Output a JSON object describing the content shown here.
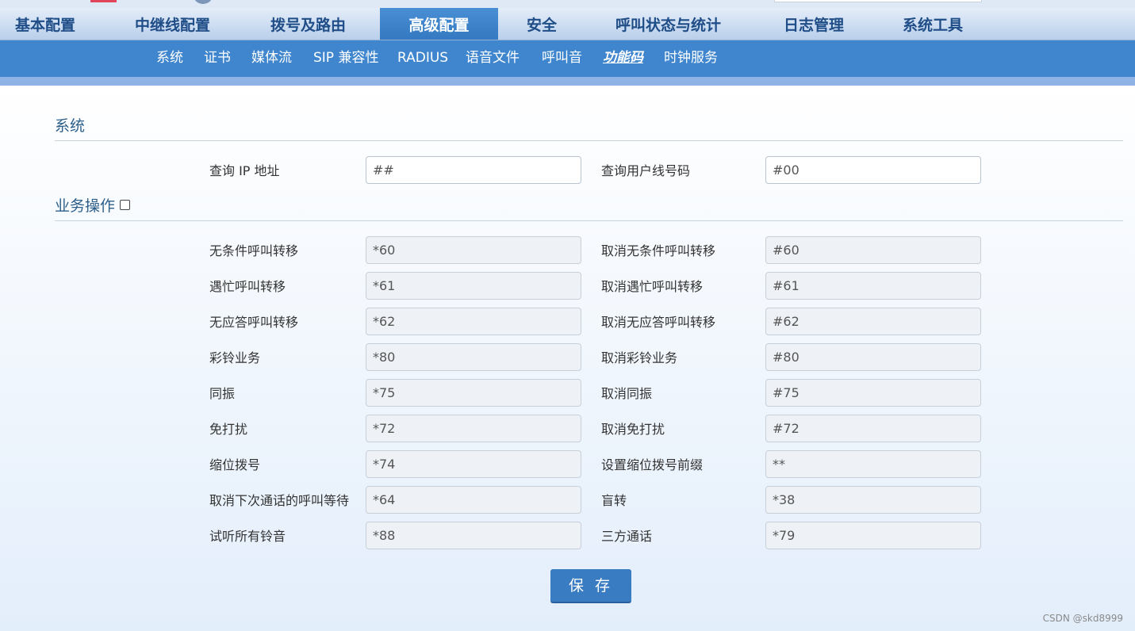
{
  "main_nav": {
    "tabs": [
      {
        "label": "基本配置",
        "active": false
      },
      {
        "label": "中继线配置",
        "active": false
      },
      {
        "label": "拨号及路由",
        "active": false
      },
      {
        "label": "高级配置",
        "active": true
      },
      {
        "label": "安全",
        "active": false
      },
      {
        "label": "呼叫状态与统计",
        "active": false
      },
      {
        "label": "日志管理",
        "active": false
      },
      {
        "label": "系统工具",
        "active": false
      }
    ]
  },
  "sub_nav": {
    "items": [
      {
        "label": "系统",
        "active": false
      },
      {
        "label": "证书",
        "active": false
      },
      {
        "label": "媒体流",
        "active": false
      },
      {
        "label": "SIP 兼容性",
        "active": false
      },
      {
        "label": "RADIUS",
        "active": false
      },
      {
        "label": "语音文件",
        "active": false
      },
      {
        "label": "呼叫音",
        "active": false
      },
      {
        "label": "功能码",
        "active": true
      },
      {
        "label": "时钟服务",
        "active": false
      }
    ]
  },
  "system_section": {
    "title": "系统",
    "fields": [
      {
        "label": "查询 IP 地址",
        "value": "##"
      },
      {
        "label": "查询用户线号码",
        "value": "#00"
      }
    ]
  },
  "service_section": {
    "title": "业务操作",
    "checkbox_checked": false,
    "rows": [
      {
        "left_label": "无条件呼叫转移",
        "left_value": "*60",
        "right_label": "取消无条件呼叫转移",
        "right_value": "#60"
      },
      {
        "left_label": "遇忙呼叫转移",
        "left_value": "*61",
        "right_label": "取消遇忙呼叫转移",
        "right_value": "#61"
      },
      {
        "left_label": "无应答呼叫转移",
        "left_value": "*62",
        "right_label": "取消无应答呼叫转移",
        "right_value": "#62"
      },
      {
        "left_label": "彩铃业务",
        "left_value": "*80",
        "right_label": "取消彩铃业务",
        "right_value": "#80"
      },
      {
        "left_label": "同振",
        "left_value": "*75",
        "right_label": "取消同振",
        "right_value": "#75"
      },
      {
        "left_label": "免打扰",
        "left_value": "*72",
        "right_label": "取消免打扰",
        "right_value": "#72"
      },
      {
        "left_label": "缩位拨号",
        "left_value": "*74",
        "right_label": "设置缩位拨号前缀",
        "right_value": "**"
      },
      {
        "left_label": "取消下次通话的呼叫等待",
        "left_value": "*64",
        "right_label": "盲转",
        "right_value": "*38"
      },
      {
        "left_label": "试听所有铃音",
        "left_value": "*88",
        "right_label": "三方通话",
        "right_value": "*79"
      }
    ]
  },
  "save_label": "保 存",
  "watermark": "CSDN @skd8999"
}
